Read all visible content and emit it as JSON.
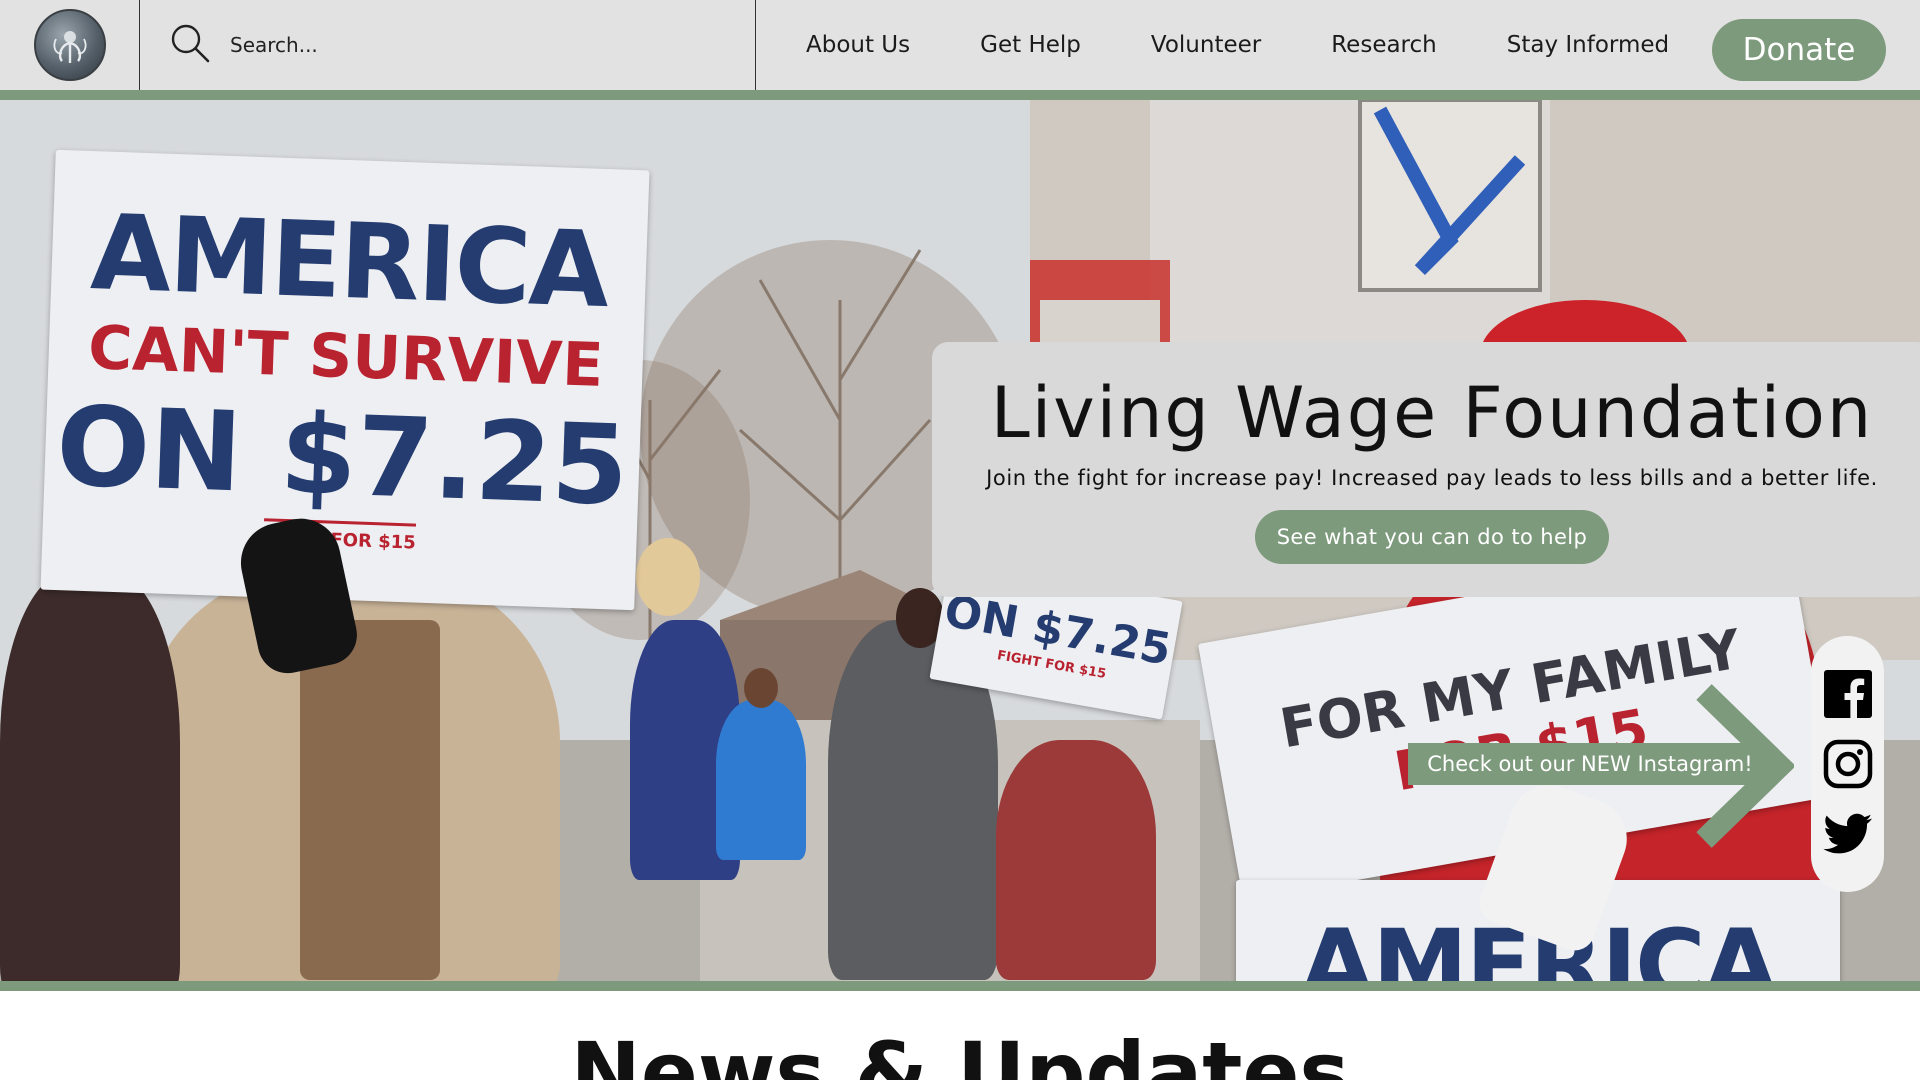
{
  "header": {
    "logo_alt": "Living Wage Foundation logo",
    "search": {
      "placeholder": "Search..."
    },
    "nav": [
      {
        "label": "About Us"
      },
      {
        "label": "Get Help"
      },
      {
        "label": "Volunteer"
      },
      {
        "label": "Research"
      },
      {
        "label": "Stay Informed"
      }
    ],
    "donate_label": "Donate"
  },
  "hero": {
    "title": "Living Wage Foundation",
    "subtitle": "Join the fight for increase pay! Increased pay leads to less bills and a better life.",
    "cta_label": "See what you can do to help",
    "signs": {
      "main": {
        "line1": "AMERICA",
        "line2": "CAN'T SURVIVE",
        "line3": "ON $7.25",
        "line4": "FIGHT FOR $15"
      },
      "small": {
        "line1": "ON $7.25",
        "line2": "FIGHT FOR $15"
      },
      "right": {
        "line1": "FOR MY FAMILY",
        "line2": "FOR $15"
      },
      "bottom": {
        "line1": "AMERICA"
      }
    },
    "instagram_callout": "Check out our NEW Instagram!"
  },
  "social": {
    "items": [
      {
        "icon": "facebook-icon"
      },
      {
        "icon": "instagram-icon"
      },
      {
        "icon": "twitter-icon"
      }
    ]
  },
  "news": {
    "title": "News & Updates"
  },
  "colors": {
    "accent": "#7d9a7c",
    "header_bg": "#e2e2e2",
    "card_bg": "#d9d9d9",
    "sign_blue": "#243c70",
    "sign_red": "#b92330"
  }
}
